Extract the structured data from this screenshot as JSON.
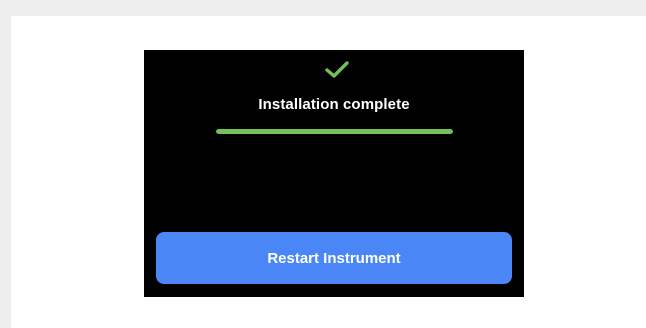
{
  "screen": {
    "status_icon": "check-icon",
    "status_title": "Installation complete",
    "progress": 1.0,
    "button_label": "Restart Instrument"
  },
  "colors": {
    "accent_green": "#74c05a",
    "button_blue": "#4a86f5",
    "screen_bg": "#000000"
  }
}
